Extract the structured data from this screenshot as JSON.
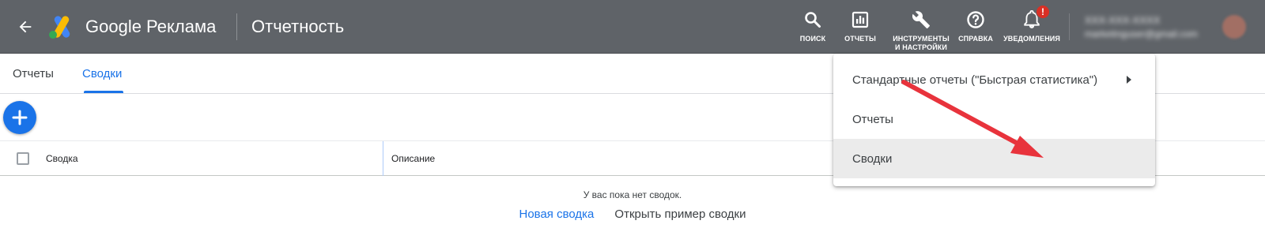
{
  "header": {
    "brand": "Google Реклама",
    "section_title": "Отчетность",
    "tools": [
      {
        "label": "ПОИСК",
        "icon": "search-icon"
      },
      {
        "label": "ОТЧЕТЫ",
        "icon": "reports-chart-icon"
      },
      {
        "label": "ИНСТРУМЕНТЫ\nИ НАСТРОЙКИ",
        "icon": "wrench-icon"
      },
      {
        "label": "СПРАВКА",
        "icon": "help-icon"
      },
      {
        "label": "УВЕДОМЛЕНИЯ",
        "icon": "bell-icon",
        "badge": "!"
      }
    ],
    "account": {
      "line1": "XXX-XXX-XXXX",
      "line2": "marketinguser@gmail.com"
    }
  },
  "tabs": [
    {
      "label": "Отчеты",
      "active": false
    },
    {
      "label": "Сводки",
      "active": true
    }
  ],
  "table": {
    "columns": [
      "Сводка",
      "Описание"
    ],
    "empty_message": "У вас пока нет сводок.",
    "actions": {
      "new_summary": "Новая сводка",
      "open_example": "Открыть пример сводки"
    }
  },
  "menu": {
    "items": [
      {
        "label": "Стандартные отчеты (\"Быстрая статистика\")",
        "has_submenu": true
      },
      {
        "label": "Отчеты",
        "has_submenu": false
      },
      {
        "label": "Сводки",
        "has_submenu": false,
        "selected": true
      }
    ]
  },
  "colors": {
    "header_bg": "#5f6368",
    "accent": "#1a73e8",
    "annotation_arrow": "#e8333c",
    "badge": "#d93025"
  }
}
